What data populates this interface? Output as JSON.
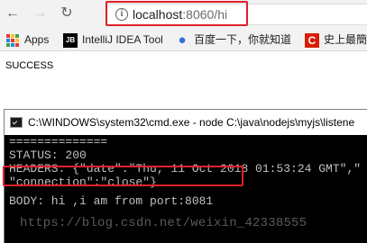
{
  "browser": {
    "nav": {
      "back_icon": "arrow-left-icon",
      "forward_icon": "arrow-right-icon",
      "reload_icon": "reload-icon"
    },
    "address_bar": {
      "icon": "info-icon",
      "host": "localhost",
      "rest": ":8060/hi"
    },
    "bookmarks": [
      {
        "label": "Apps",
        "icon": "apps-grid-icon"
      },
      {
        "label": "IntelliJ IDEA Tool",
        "icon": "jetbrains-icon"
      },
      {
        "label": "百度一下，你就知道",
        "icon": "baidu-paw-icon"
      },
      {
        "label": "史上最簡",
        "icon": "csdn-icon"
      }
    ]
  },
  "page": {
    "text": "SUCCESS"
  },
  "cmd": {
    "title": "C:\\WINDOWS\\system32\\cmd.exe - node  C:\\java\\nodejs\\myjs\\listene",
    "lines": {
      "separator": "==============",
      "status": "STATUS: 200",
      "headers": "HEADERS: {\"date\":\"Thu, 11 Oct 2018 01:53:24 GMT\",\"",
      "connection": "\"connection\":\"close\"}",
      "body": "BODY: hi ,i am from port:8081"
    }
  },
  "watermark": "https://blog.csdn.net/weixin_42338555",
  "colors": {
    "highlight": "#e0202a",
    "console_bg": "#000000",
    "console_text": "#c0c0c0"
  }
}
